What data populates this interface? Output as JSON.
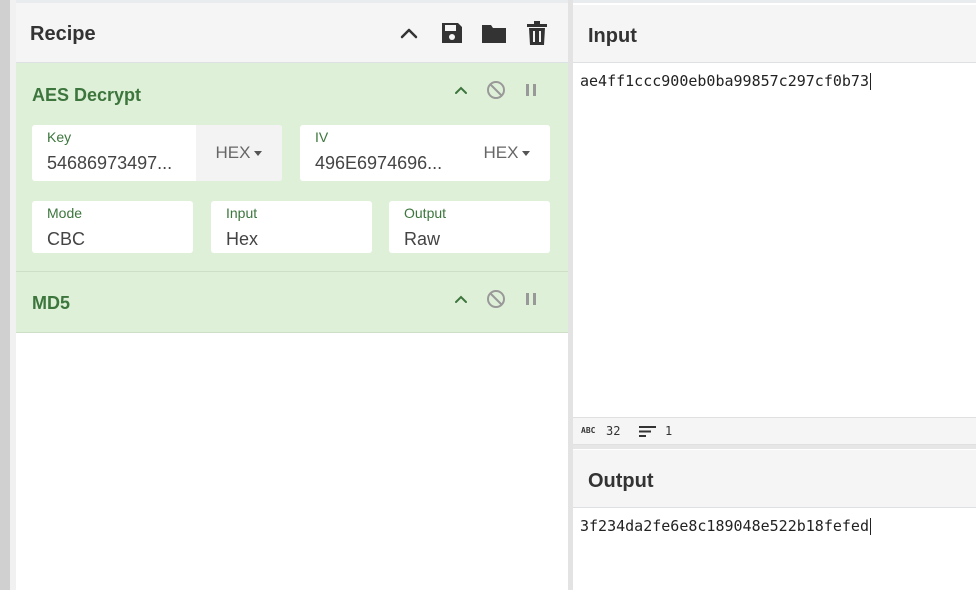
{
  "recipe": {
    "title": "Recipe",
    "operations": [
      {
        "name": "AES Decrypt",
        "fields": {
          "key": {
            "label": "Key",
            "value": "54686973497...",
            "encoding": "HEX"
          },
          "iv": {
            "label": "IV",
            "value": "496E6974696...",
            "encoding": "HEX"
          },
          "mode": {
            "label": "Mode",
            "value": "CBC"
          },
          "input": {
            "label": "Input",
            "value": "Hex"
          },
          "output": {
            "label": "Output",
            "value": "Raw"
          }
        }
      },
      {
        "name": "MD5"
      }
    ],
    "icons": [
      "chevron-up-icon",
      "save-icon",
      "folder-icon",
      "trash-icon"
    ]
  },
  "input": {
    "title": "Input",
    "value": "ae4ff1ccc900eb0ba99857c297cf0b73",
    "status": {
      "length_icon": "ABC",
      "length": "32",
      "lines": "1"
    }
  },
  "output": {
    "title": "Output",
    "value": "3f234da2fe6e8c189048e522b18fefed"
  },
  "colors": {
    "accent_green": "#3c763d",
    "op_background": "#dff0d8"
  }
}
